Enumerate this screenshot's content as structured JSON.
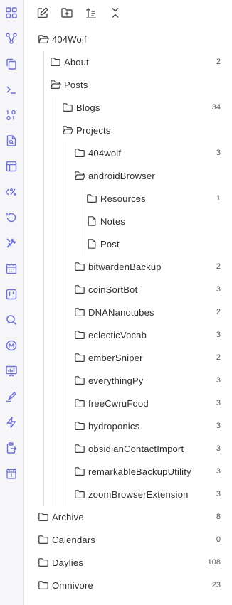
{
  "ribbon": {
    "items": [
      {
        "icon": "grid-icon"
      },
      {
        "icon": "graph-icon"
      },
      {
        "icon": "copy-icon"
      },
      {
        "icon": "terminal-icon"
      },
      {
        "icon": "binary-icon"
      },
      {
        "icon": "file-search-icon"
      },
      {
        "icon": "layout-icon"
      },
      {
        "icon": "percent-code-icon"
      },
      {
        "icon": "history-icon"
      },
      {
        "icon": "tools-icon"
      },
      {
        "icon": "calendar-icon"
      },
      {
        "icon": "kanban-icon"
      },
      {
        "icon": "search-icon"
      },
      {
        "icon": "m-circle-icon"
      },
      {
        "icon": "presentation-icon"
      },
      {
        "icon": "highlighter-icon"
      },
      {
        "icon": "bolt-icon"
      },
      {
        "icon": "clipboard-export-icon"
      },
      {
        "icon": "calendar-day-icon"
      }
    ]
  },
  "toolbar": {
    "buttons": [
      {
        "icon": "new-note-icon"
      },
      {
        "icon": "new-folder-icon"
      },
      {
        "icon": "sort-icon"
      },
      {
        "icon": "collapse-all-icon"
      }
    ]
  },
  "tree": {
    "items": [
      {
        "label": "404Wolf",
        "count": "",
        "type": "folder-open"
      },
      {
        "label": "About",
        "count": "2",
        "type": "folder"
      },
      {
        "label": "Posts",
        "count": "",
        "type": "folder-open"
      },
      {
        "label": "Blogs",
        "count": "34",
        "type": "folder"
      },
      {
        "label": "Projects",
        "count": "",
        "type": "folder-open"
      },
      {
        "label": "404wolf",
        "count": "3",
        "type": "folder"
      },
      {
        "label": "androidBrowser",
        "count": "",
        "type": "folder-open"
      },
      {
        "label": "Resources",
        "count": "1",
        "type": "folder"
      },
      {
        "label": "Notes",
        "count": "",
        "type": "file"
      },
      {
        "label": "Post",
        "count": "",
        "type": "file"
      },
      {
        "label": "bitwardenBackup",
        "count": "2",
        "type": "folder"
      },
      {
        "label": "coinSortBot",
        "count": "3",
        "type": "folder"
      },
      {
        "label": "DNANanotubes",
        "count": "2",
        "type": "folder"
      },
      {
        "label": "eclecticVocab",
        "count": "3",
        "type": "folder"
      },
      {
        "label": "emberSniper",
        "count": "2",
        "type": "folder"
      },
      {
        "label": "everythingPy",
        "count": "3",
        "type": "folder"
      },
      {
        "label": "freeCwruFood",
        "count": "3",
        "type": "folder"
      },
      {
        "label": "hydroponics",
        "count": "3",
        "type": "folder"
      },
      {
        "label": "obsidianContactImport",
        "count": "3",
        "type": "folder"
      },
      {
        "label": "remarkableBackupUtility",
        "count": "3",
        "type": "folder"
      },
      {
        "label": "zoomBrowserExtension",
        "count": "3",
        "type": "folder"
      },
      {
        "label": "Archive",
        "count": "8",
        "type": "folder"
      },
      {
        "label": "Calendars",
        "count": "0",
        "type": "folder"
      },
      {
        "label": "Daylies",
        "count": "108",
        "type": "folder"
      },
      {
        "label": "Omnivore",
        "count": "23",
        "type": "folder"
      }
    ]
  }
}
